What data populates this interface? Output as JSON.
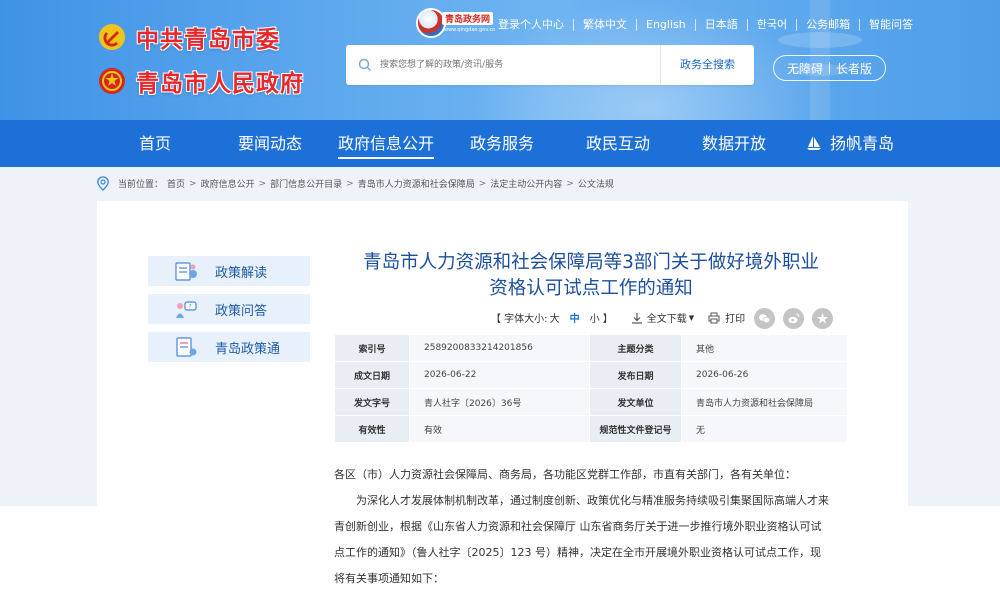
{
  "header": {
    "party_name": "中共青岛市委",
    "gov_name": "青岛市人民政府",
    "portal_badge": "青岛政务网",
    "portal_badge_sub": "www.qingdao.gov.cn",
    "top_links": [
      "登录个人中心",
      "繁体中文",
      "English",
      "日本語",
      "한국어",
      "公务邮箱",
      "智能问答"
    ],
    "search_placeholder": "搜索您想了解的政策/资讯/服务",
    "search_button": "政务全搜索",
    "accessibility": "无障碍",
    "elder_mode": "长者版"
  },
  "nav": {
    "items": [
      "首页",
      "要闻动态",
      "政府信息公开",
      "政务服务",
      "政民互动",
      "数据开放",
      "扬帆青岛"
    ],
    "active": "政府信息公开"
  },
  "breadcrumb": {
    "label": "当前位置：",
    "items": [
      "首页",
      "政府信息公开",
      "部门信息公开目录",
      "青岛市人力资源和社会保障局",
      "法定主动公开内容",
      "公文法规"
    ],
    "separator": ">"
  },
  "sidebar": {
    "items": [
      "政策解读",
      "政策问答",
      "青岛政策通"
    ]
  },
  "article": {
    "title_line1": "青岛市人力资源和社会保障局等3部门关于做好境外职业",
    "title_line2": "资格认可试点工作的通知",
    "toolbar": {
      "font_label": "【 字体大小:",
      "size_large": "大",
      "size_medium": "中",
      "size_small": "小 】",
      "download": "全文下载",
      "print": "打印"
    },
    "meta": [
      {
        "k1": "索引号",
        "v1": "2589200833214201856",
        "k2": "主题分类",
        "v2": "其他"
      },
      {
        "k1": "成文日期",
        "v1": "2026-06-22",
        "k2": "发布日期",
        "v2": "2026-06-26"
      },
      {
        "k1": "发文字号",
        "v1": "青人社字〔2026〕36号",
        "k2": "发文单位",
        "v2": "青岛市人力资源和社会保障局"
      },
      {
        "k1": "有效性",
        "v1": "有效",
        "k2": "规范性文件登记号",
        "v2": "无"
      }
    ],
    "salutation": "各区（市）人力资源社会保障局、商务局，各功能区党群工作部，市直有关部门，各有关单位：",
    "body_lines": [
      "为深化人才发展体制机制改革，通过制度创新、政策优化与精准服务持续吸引集聚国际高端人才来",
      "青创新创业，根据《山东省人力资源和社会保障厅 山东省商务厅关于进一步推行境外职业资格认可试",
      "点工作的通知》（鲁人社字〔2025〕123 号）精神，决定在全市开展境外职业资格认可试点工作，现",
      "将有关事项通知如下："
    ]
  },
  "colors": {
    "nav_bg": "#1d70d8",
    "header_bg": "#4d9de9",
    "title": "#1d4fa0",
    "brand_red": "#e8262b"
  }
}
